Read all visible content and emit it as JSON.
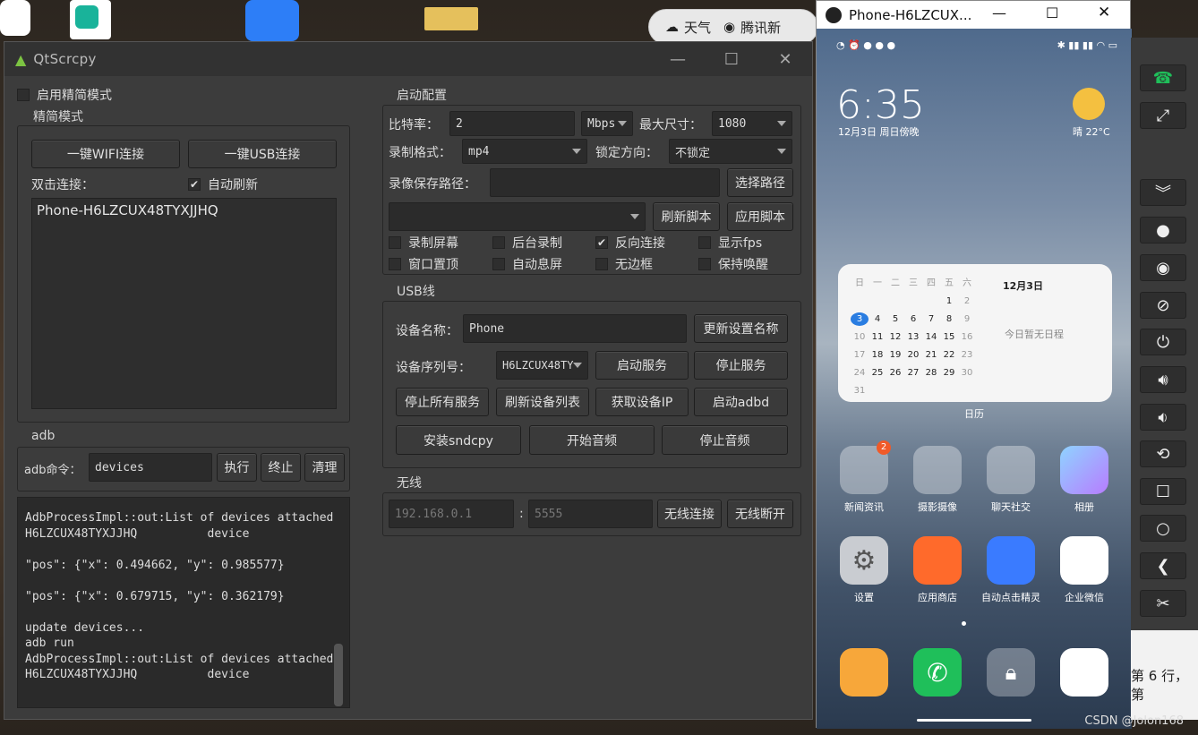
{
  "desktop": {
    "taskbar_weather": "天气",
    "taskbar_news": "腾讯新",
    "bottom_right_text": "第 6 行，第",
    "watermark": "CSDN @Jolon168"
  },
  "window": {
    "title": "QtScrcpy",
    "min": "—",
    "max": "☐",
    "close": "✕"
  },
  "simple_mode": {
    "checkbox_label": "启用精简模式",
    "group_label": "精简模式",
    "wifi_button": "一键WIFI连接",
    "usb_button": "一键USB连接",
    "double_click_label": "双击连接：",
    "auto_refresh_label": "自动刷新",
    "devices": [
      "Phone-H6LZCUX48TYXJJHQ"
    ]
  },
  "adb": {
    "group_label": "adb",
    "cmd_label": "adb命令：",
    "cmd_value": "devices",
    "exec_button": "执行",
    "stop_button": "终止",
    "clear_button": "清理",
    "log": "AdbProcessImpl::out:List of devices attached\nH6LZCUX48TYXJJHQ          device\n\n\"pos\": {\"x\": 0.494662, \"y\": 0.985577}\n\n\"pos\": {\"x\": 0.679715, \"y\": 0.362179}\n\nupdate devices...\nadb run\nAdbProcessImpl::out:List of devices attached\nH6LZCUX48TYXJJHQ          device"
  },
  "start_config": {
    "group_label": "启动配置",
    "bitrate_label": "比特率：",
    "bitrate_value": "2",
    "bitrate_unit": "Mbps",
    "max_size_label": "最大尺寸：",
    "max_size_value": "1080",
    "record_format_label": "录制格式：",
    "record_format_value": "mp4",
    "lock_orientation_label": "锁定方向：",
    "lock_orientation_value": "不锁定",
    "save_path_label": "录像保存路径：",
    "save_path_value": "",
    "choose_path_button": "选择路径",
    "script_value": "",
    "refresh_script_button": "刷新脚本",
    "apply_script_button": "应用脚本",
    "options": [
      {
        "label": "录制屏幕",
        "checked": false
      },
      {
        "label": "后台录制",
        "checked": false
      },
      {
        "label": "反向连接",
        "checked": true
      },
      {
        "label": "显示fps",
        "checked": false
      },
      {
        "label": "窗口置顶",
        "checked": false
      },
      {
        "label": "自动息屏",
        "checked": false
      },
      {
        "label": "无边框",
        "checked": false
      },
      {
        "label": "保持唤醒",
        "checked": false
      }
    ]
  },
  "usb": {
    "group_label": "USB线",
    "device_name_label": "设备名称：",
    "device_name_value": "Phone",
    "update_name_button": "更新设置名称",
    "serial_label": "设备序列号：",
    "serial_value": "H6LZCUX48TY",
    "start_service_button": "启动服务",
    "stop_service_button": "停止服务",
    "stop_all_button": "停止所有服务",
    "refresh_list_button": "刷新设备列表",
    "get_ip_button": "获取设备IP",
    "start_adbd_button": "启动adbd",
    "install_sndcpy_button": "安装sndcpy",
    "start_audio_button": "开始音频",
    "stop_audio_button": "停止音频"
  },
  "wireless": {
    "group_label": "无线",
    "ip_placeholder": "192.168.0.1",
    "colon": ":",
    "port_placeholder": "5555",
    "connect_button": "无线连接",
    "disconnect_button": "无线断开"
  },
  "phone": {
    "window_title": "Phone-H6LZCUX...",
    "clock": "6:35",
    "date": "12月3日 周日傍晚",
    "weather": "晴  22°C",
    "calendar": {
      "title": "12月3日",
      "empty": "今日暂无日程",
      "weekdays": [
        "日",
        "一",
        "二",
        "三",
        "四",
        "五",
        "六"
      ],
      "days": [
        "",
        "",
        "",
        "",
        "",
        "1",
        "2",
        "3",
        "4",
        "5",
        "6",
        "7",
        "8",
        "9",
        "10",
        "11",
        "12",
        "13",
        "14",
        "15",
        "16",
        "17",
        "18",
        "19",
        "20",
        "21",
        "22",
        "23",
        "24",
        "25",
        "26",
        "27",
        "28",
        "29",
        "30",
        "31"
      ],
      "widget_label": "日历"
    },
    "apps": [
      {
        "label": "新闻资讯",
        "badge": "2"
      },
      {
        "label": "摄影摄像",
        "badge": ""
      },
      {
        "label": "聊天社交",
        "badge": ""
      },
      {
        "label": "相册",
        "badge": ""
      },
      {
        "label": "设置",
        "badge": ""
      },
      {
        "label": "应用商店",
        "badge": ""
      },
      {
        "label": "自动点击精灵",
        "badge": ""
      },
      {
        "label": "企业微信",
        "badge": ""
      }
    ],
    "colors": {
      "accent": "#2a7de1",
      "phone_green": "#1fbf5a"
    }
  }
}
